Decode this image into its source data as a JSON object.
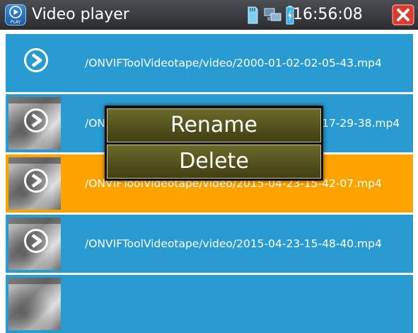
{
  "app": {
    "title": "Video player",
    "icon_label": "PLAY",
    "clock": "16:56:08"
  },
  "status_icons": [
    "sd-card-icon",
    "network-icon",
    "battery-charging-icon"
  ],
  "colors": {
    "titlebar": "#3a3c40",
    "row_default": "#299bd3",
    "row_selected": "#fda300",
    "menu_item": "#55551f",
    "close": "#e03a2e"
  },
  "files": [
    {
      "path": "/ONVIFToolVideotape/video/2000-01-02-02-05-43.mp4",
      "has_thumbnail": false,
      "selected": false
    },
    {
      "path": "/ONVIFToolVideotape/video/2015-04-23-15-17-29-38.mp4",
      "has_thumbnail": true,
      "selected": false
    },
    {
      "path": "/ONVIFToolVideotape/video/2015-04-23-15-42-07.mp4",
      "has_thumbnail": true,
      "selected": true
    },
    {
      "path": "/ONVIFToolVideotape/video/2015-04-23-15-48-40.mp4",
      "has_thumbnail": true,
      "selected": false
    }
  ],
  "context_menu": {
    "rename_label": "Rename",
    "delete_label": "Delete"
  }
}
